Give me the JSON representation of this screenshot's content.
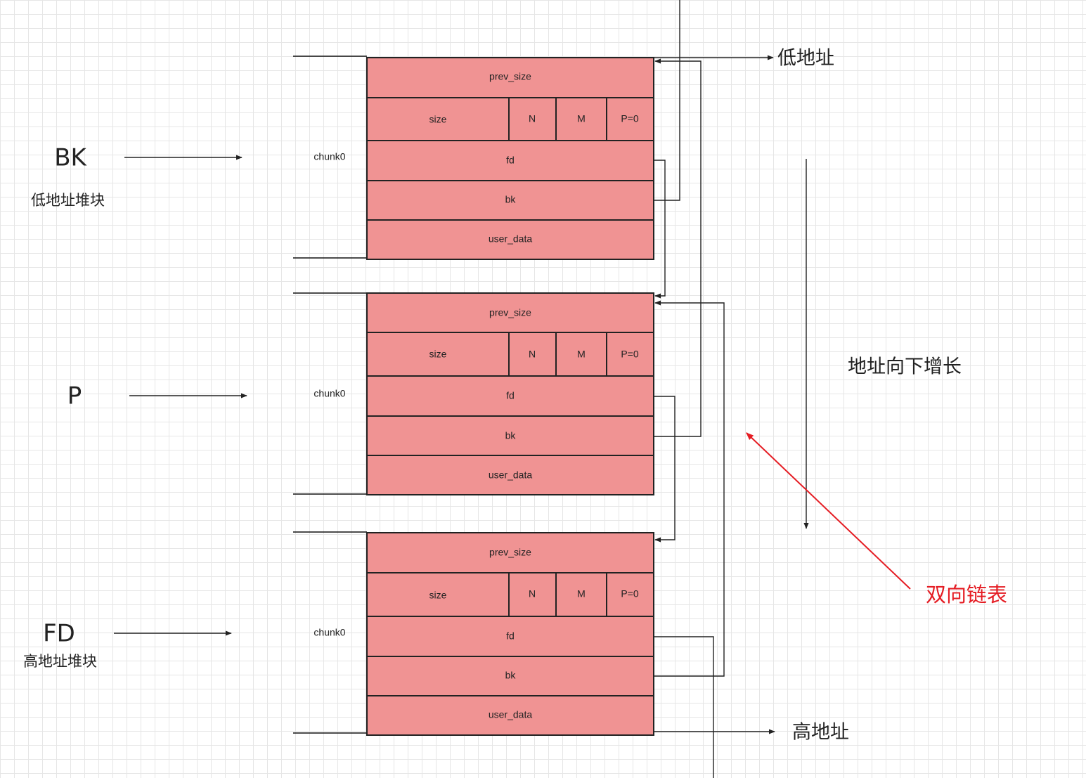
{
  "chunks": [
    {
      "label": "chunk0",
      "fields": {
        "prev_size": "prev_size",
        "size": "size",
        "n": "N",
        "m": "M",
        "p": "P=0",
        "fd": "fd",
        "bk": "bk",
        "user_data": "user_data"
      }
    },
    {
      "label": "chunk0",
      "fields": {
        "prev_size": "prev_size",
        "size": "size",
        "n": "N",
        "m": "M",
        "p": "P=0",
        "fd": "fd",
        "bk": "bk",
        "user_data": "user_data"
      }
    },
    {
      "label": "chunk0",
      "fields": {
        "prev_size": "prev_size",
        "size": "size",
        "n": "N",
        "m": "M",
        "p": "P=0",
        "fd": "fd",
        "bk": "bk",
        "user_data": "user_data"
      }
    }
  ],
  "pointers": {
    "bk": {
      "name": "BK",
      "caption": "低地址堆块"
    },
    "p": {
      "name": "P"
    },
    "fd": {
      "name": "FD",
      "caption": "高地址堆块"
    }
  },
  "labels": {
    "low_address": "低地址",
    "high_address": "高地址",
    "growth": "地址向下增长",
    "doubly_linked_list": "双向链表"
  },
  "colors": {
    "chunk_fill": "#f09393",
    "highlight": "#e51c23"
  }
}
